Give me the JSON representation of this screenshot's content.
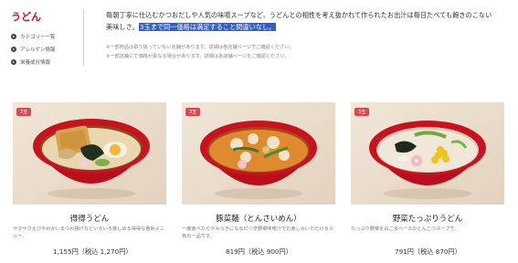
{
  "sidebar": {
    "title": "うどん",
    "items": [
      {
        "label": "カテゴリー一覧"
      },
      {
        "label": "アレルゲン情報"
      },
      {
        "label": "栄養成分情報"
      }
    ]
  },
  "intro": {
    "line1": "毎朝丁寧に仕込むかつおだしや人気の味噌スープなど、うどんとの相性を考え抜かれて作られたお出汁は毎日たべても飽きのこない",
    "line2_pre": "美味しさ。",
    "line2_highlight": "3玉まで同一価格は満足すること間違いなし。",
    "note1": "※一部商品は取り扱っていない店舗があります。詳細は各店舗ページでご確認ください。",
    "note2": "※一部店舗にて価格が異なる場合があります。詳細は各店舗ページをご確認ください。"
  },
  "products": [
    {
      "badge": "3玉",
      "name": "得得うどん",
      "desc": "サクサクえびやわかいまつわ揚げなどいろいろ楽しめる得得な看板メニュー。",
      "price": "1,155円（税込 1,270円）"
    },
    {
      "badge": "3玉",
      "name": "豚菜麺（とんさいめん）",
      "desc": "一度食べたらやみつきになるピリ辛野菜味噌汁でお楽しみいただける人気の一品です。",
      "price": "819円（税込 900円）"
    },
    {
      "badge": "3玉",
      "name": "野菜たっぷりうどん",
      "desc": "たっぷり野菜を白ごまベースのとんこつスープで。",
      "price": "791円（税込 870円）"
    }
  ]
}
